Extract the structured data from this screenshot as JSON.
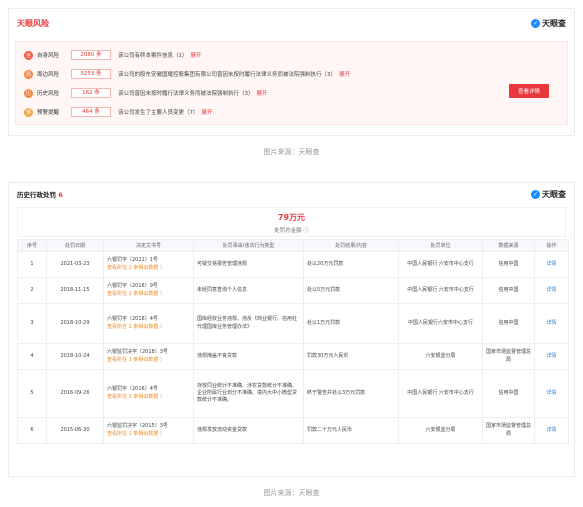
{
  "risk_card": {
    "title": "天眼风险",
    "logo_text": "天眼查",
    "button": "查看详情",
    "rows": [
      {
        "icon": "自",
        "name": "自身风险",
        "count": "2080 条",
        "text": "该公司有终本案件信息（1）",
        "more": "展开",
        "icon_color": "#f5583b"
      },
      {
        "icon": "周",
        "name": "周边风险",
        "count": "3253 条",
        "text": "该公司的股东安徽国耀控股集团有限公司曾因未按时履行法律义务而被法院强制执行（3）",
        "more": "展开",
        "icon_color": "#f7813a"
      },
      {
        "icon": "历",
        "name": "历史风险",
        "count": "162 条",
        "text": "该公司曾因未按时履行法律义务而被法院强制执行（3）",
        "more": "展开",
        "icon_color": "#f7813a"
      },
      {
        "icon": "预",
        "name": "预警提醒",
        "count": "464 条",
        "text": "该公司发生了主要人员变更（7）",
        "more": "展开",
        "icon_color": "#f2a33a"
      }
    ]
  },
  "caption1": "图片来源：天眼查",
  "penalty_card": {
    "title": "历史行政处罚",
    "title_count": "6",
    "logo_text": "天眼查",
    "amount": "79万元",
    "amount_label": "处罚总金额 ⓘ",
    "headers": [
      "序号",
      "处罚日期",
      "决定文书号",
      "处罚事由/违法行为类型",
      "处罚结果/内容",
      "处罚单位",
      "数据来源",
      "操作"
    ],
    "rows": [
      {
        "no": "1",
        "date": "2021-03-23",
        "doc": "六银罚字〔2021〕1号",
        "doc_link": "查看所在 1 条相似数据 〉",
        "reason": "可疑交易报告管理违规",
        "result": "处以20万元罚款",
        "org": "中国人民银行 六安市中心支行",
        "source": "信用中国",
        "op": "详情"
      },
      {
        "no": "2",
        "date": "2018-11-15",
        "doc": "六银罚字〔2018〕9号",
        "doc_link": "查看所在 1 条相似数据 〉",
        "reason": "未经同意查询个人信息",
        "result": "处以5万元罚款",
        "org": "中国人民银行 六安市中心支行",
        "source": "信用中国",
        "op": "详情"
      },
      {
        "no": "3",
        "date": "2018-10-29",
        "doc": "六银罚字〔2018〕4号",
        "doc_link": "查看所在 1 条相似数据 〉",
        "reason": "国库经收业务违规、违反《商业银行、信用社代理国库业务管理办法》",
        "result": "处以1万元罚款",
        "org": "中国人民银行六安市中心支行",
        "source": "信用中国",
        "op": "详情"
      },
      {
        "no": "4",
        "date": "2018-10-24",
        "doc": "六银监罚决字〔2018〕3号",
        "doc_link": "查看所在 1 条相似数据 〉",
        "reason": "违规掩盖不良贷款",
        "result": "罚款30万元人民币",
        "org": "六安银监分局",
        "source": "国家市场监督管理总局",
        "op": "详情"
      },
      {
        "no": "5",
        "date": "2016-09-26",
        "doc": "六银罚字〔2016〕4号",
        "doc_link": "查看所在 1 条相似数据 〉",
        "reason": "存放同业统计不准确、涉农贷款统计不准确、企业所属行业划分不准确、境内大中小微型贷款统计不准确。",
        "result": "终于警告并处以3万元罚款",
        "org": "中国人民银行 六安市中心支行",
        "source": "信用中国",
        "op": "详情"
      },
      {
        "no": "6",
        "date": "2015-06-30",
        "doc": "六银监罚决字〔2015〕3号",
        "doc_link": "查看所在 1 条相似数据 〉",
        "reason": "违规发放流动资金贷款",
        "result": "罚款二十万元人民币",
        "org": "六安银监分局",
        "source": "国家市场监督管理总局",
        "op": "详情"
      }
    ]
  },
  "caption2": "图片来源：天眼查"
}
